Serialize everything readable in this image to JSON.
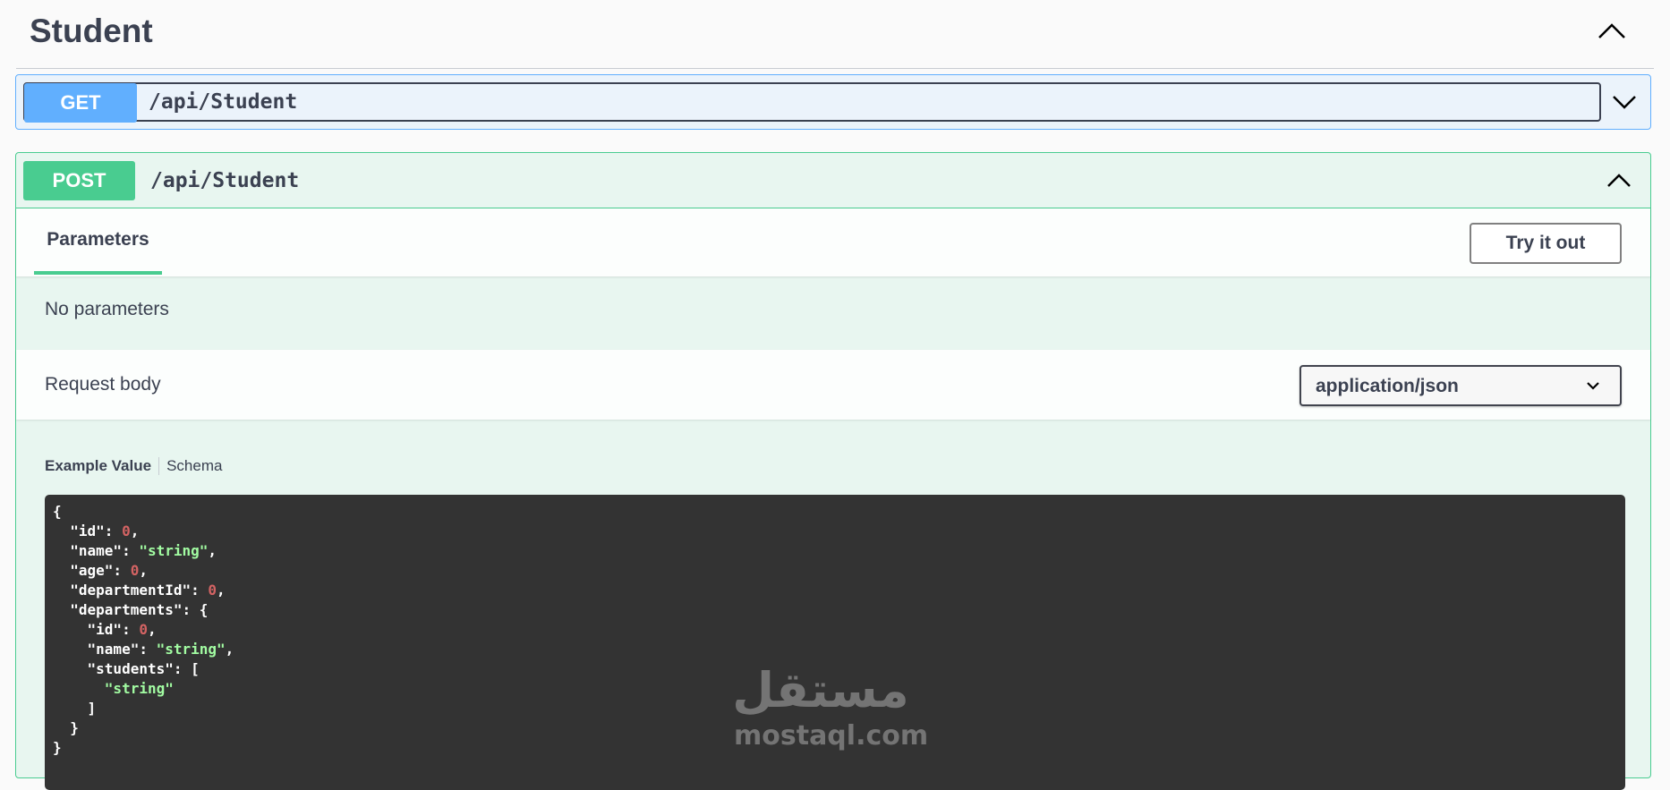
{
  "tag": {
    "title": "Student",
    "toggle_icon": "chevron-up-icon"
  },
  "get_op": {
    "method": "GET",
    "path": "/api/Student",
    "toggle_icon": "chevron-down-icon",
    "color": "#61affe"
  },
  "post_op": {
    "method": "POST",
    "path": "/api/Student",
    "toggle_icon": "chevron-up-icon",
    "color": "#49cc90",
    "tab_parameters": "Parameters",
    "try_button": "Try it out",
    "no_parameters": "No parameters",
    "request_body_label": "Request body",
    "content_type": "application/json",
    "example_tab": "Example Value",
    "schema_tab": "Schema",
    "example_lines": [
      "{",
      "  \"id\": 0,",
      "  \"name\": \"string\",",
      "  \"age\": 0,",
      "  \"departmentId\": 0,",
      "  \"departments\": {",
      "    \"id\": 0,",
      "    \"name\": \"string\",",
      "    \"students\": [",
      "      \"string\"",
      "    ]",
      "  }",
      "}"
    ]
  },
  "watermark": {
    "arabic": "مستقل",
    "text": "mostaql.com"
  }
}
